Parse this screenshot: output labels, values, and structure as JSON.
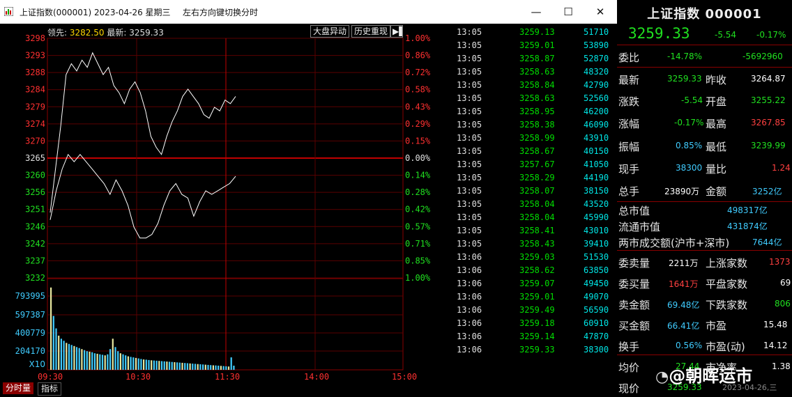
{
  "window": {
    "title": "上证指数(000001) 2023-04-26 星期三",
    "hint": "左右方向键切换分时",
    "minimize": "—",
    "maximize": "☐",
    "close": "✕"
  },
  "chart": {
    "lead_label": "领先:",
    "lead_value": "3282.50",
    "latest_label": "最新:",
    "latest_value": "3259.33",
    "btn_market": "大盘异动",
    "btn_history": "历史重现",
    "y_left": [
      "3298",
      "3293",
      "3288",
      "3284",
      "3279",
      "3274",
      "3270",
      "3265",
      "3260",
      "3256",
      "3251",
      "3246",
      "3242",
      "3237",
      "3232"
    ],
    "y_right": [
      "1.00%",
      "0.86%",
      "0.72%",
      "0.58%",
      "0.43%",
      "0.29%",
      "0.15%",
      "0.00%",
      "0.14%",
      "0.28%",
      "0.42%",
      "0.57%",
      "0.71%",
      "0.85%",
      "1.00%"
    ],
    "vol_labels": [
      "793995",
      "597387",
      "400779",
      "204170"
    ],
    "vol_unit": "X10",
    "x_labels": [
      "09:30",
      "10:30",
      "11:30",
      "14:00",
      "15:00"
    ],
    "tab_minute_volume": "分时量",
    "tab_indicator": "指标"
  },
  "chart_data": {
    "type": "line",
    "title": "",
    "xlabel": "",
    "ylabel": "",
    "ylim": [
      3232,
      3298
    ],
    "prev_close": 3265,
    "x_ticks": [
      "09:30",
      "10:30",
      "11:30",
      "14:00",
      "15:00"
    ],
    "series": [
      {
        "values": [
          3250,
          3262,
          3274,
          3288,
          3291,
          3289,
          3292,
          3290,
          3294,
          3291,
          3288,
          3290,
          3285,
          3283,
          3280,
          3284,
          3286,
          3283,
          3278,
          3271,
          3268,
          3266,
          3271,
          3275,
          3278,
          3282,
          3284,
          3282,
          3280,
          3277,
          3276,
          3279,
          3278,
          3281,
          3280,
          3282
        ]
      },
      {
        "values": [
          3248,
          3256,
          3262,
          3266,
          3264,
          3266,
          3264,
          3262,
          3260,
          3258,
          3255,
          3259,
          3256,
          3252,
          3246,
          3243,
          3243,
          3244,
          3247,
          3252,
          3256,
          3258,
          3255,
          3254,
          3249,
          3253,
          3256,
          3255,
          3256,
          3257,
          3258,
          3260
        ]
      },
      {
        "values": [
          793995,
          520000,
          400000,
          330000,
          300000,
          280000,
          260000,
          250000,
          240000,
          230000,
          220000,
          210000,
          200000,
          190000,
          180000,
          175000,
          170000,
          160000,
          155000,
          150000,
          145000,
          140000,
          150000,
          200000,
          300000,
          220000,
          180000,
          160000,
          150000,
          140000,
          130000,
          125000,
          120000,
          115000,
          110000,
          105000,
          100000,
          98000,
          95000,
          92000,
          90000,
          88000,
          86000,
          84000,
          82000,
          80000,
          78000,
          76000,
          74000,
          72000,
          70000,
          68000,
          66000,
          64000,
          62000,
          60000,
          58000,
          56000,
          54000,
          52000,
          50000,
          48000,
          46000,
          44000,
          42000,
          40000,
          38000,
          36000,
          34000,
          32000,
          120000,
          40000
        ]
      }
    ]
  },
  "ticks": [
    {
      "time": "13:05",
      "price": "3259.13",
      "vol": "51710"
    },
    {
      "time": "13:05",
      "price": "3259.01",
      "vol": "53890"
    },
    {
      "time": "13:05",
      "price": "3258.87",
      "vol": "52870"
    },
    {
      "time": "13:05",
      "price": "3258.63",
      "vol": "48320"
    },
    {
      "time": "13:05",
      "price": "3258.84",
      "vol": "42790"
    },
    {
      "time": "13:05",
      "price": "3258.63",
      "vol": "52560"
    },
    {
      "time": "13:05",
      "price": "3258.95",
      "vol": "46200"
    },
    {
      "time": "13:05",
      "price": "3258.38",
      "vol": "46090"
    },
    {
      "time": "13:05",
      "price": "3258.99",
      "vol": "43910"
    },
    {
      "time": "13:05",
      "price": "3258.67",
      "vol": "40150"
    },
    {
      "time": "13:05",
      "price": "3257.67",
      "vol": "41050"
    },
    {
      "time": "13:05",
      "price": "3258.29",
      "vol": "44190"
    },
    {
      "time": "13:05",
      "price": "3258.07",
      "vol": "38150"
    },
    {
      "time": "13:05",
      "price": "3258.04",
      "vol": "43520"
    },
    {
      "time": "13:05",
      "price": "3258.04",
      "vol": "45990"
    },
    {
      "time": "13:05",
      "price": "3258.41",
      "vol": "43010"
    },
    {
      "time": "13:05",
      "price": "3258.43",
      "vol": "39410"
    },
    {
      "time": "13:06",
      "price": "3259.03",
      "vol": "51530"
    },
    {
      "time": "13:06",
      "price": "3258.62",
      "vol": "63850"
    },
    {
      "time": "13:06",
      "price": "3259.07",
      "vol": "49450"
    },
    {
      "time": "13:06",
      "price": "3259.01",
      "vol": "49070"
    },
    {
      "time": "13:06",
      "price": "3259.49",
      "vol": "56590"
    },
    {
      "time": "13:06",
      "price": "3259.18",
      "vol": "60910"
    },
    {
      "time": "13:06",
      "price": "3259.14",
      "vol": "47870"
    },
    {
      "time": "13:06",
      "price": "3259.33",
      "vol": "38300"
    }
  ],
  "panel": {
    "name": "上证指数 000001",
    "price": "3259.33",
    "change": "-5.54",
    "change_pct": "-0.17%",
    "weibi_label": "委比",
    "weibi_pct": "-14.78%",
    "weibi_diff": "-5692960",
    "latest_label": "最新",
    "latest": "3259.33",
    "prev_close_label": "昨收",
    "prev_close": "3264.87",
    "chg_label": "涨跌",
    "chg": "-5.54",
    "open_label": "开盘",
    "open": "3255.22",
    "chgpct_label": "涨幅",
    "chgpct": "-0.17%",
    "high_label": "最高",
    "high": "3267.85",
    "amp_label": "振幅",
    "amp": "0.85%",
    "low_label": "最低",
    "low": "3239.99",
    "cur_vol_label": "现手",
    "cur_vol": "38300",
    "vol_ratio_label": "量比",
    "vol_ratio": "1.24",
    "total_vol_label": "总手",
    "total_vol": "23890万",
    "amount_label": "金额",
    "amount": "3252亿",
    "total_mv_label": "总市值",
    "total_mv": "498317亿",
    "float_mv_label": "流通市值",
    "float_mv": "431874亿",
    "two_mkt_label": "两市成交额(沪市+深市)",
    "two_mkt": "7644亿",
    "sell_vol_label": "委卖量",
    "sell_vol": "2211万",
    "up_cnt_label": "上涨家数",
    "up_cnt": "1373",
    "buy_vol_label": "委买量",
    "buy_vol": "1641万",
    "flat_cnt_label": "平盘家数",
    "flat_cnt": "69",
    "sell_amt_label": "卖金额",
    "sell_amt": "69.48亿",
    "down_cnt_label": "下跌家数",
    "down_cnt": "806",
    "buy_amt_label": "买金额",
    "buy_amt": "66.41亿",
    "pe_label": "市盈",
    "pe": "15.48",
    "turnover_label": "换手",
    "turnover": "0.56%",
    "pe_dyn_label": "市盈(动)",
    "pe_dyn": "14.12",
    "avg_label": "均价",
    "avg": "27.44",
    "pb_label": "市净率",
    "pb": "1.38",
    "now_label": "现价",
    "now": "3259.33"
  },
  "watermark": {
    "text": "@朝晖运市",
    "date": "2023-04-26,三"
  }
}
